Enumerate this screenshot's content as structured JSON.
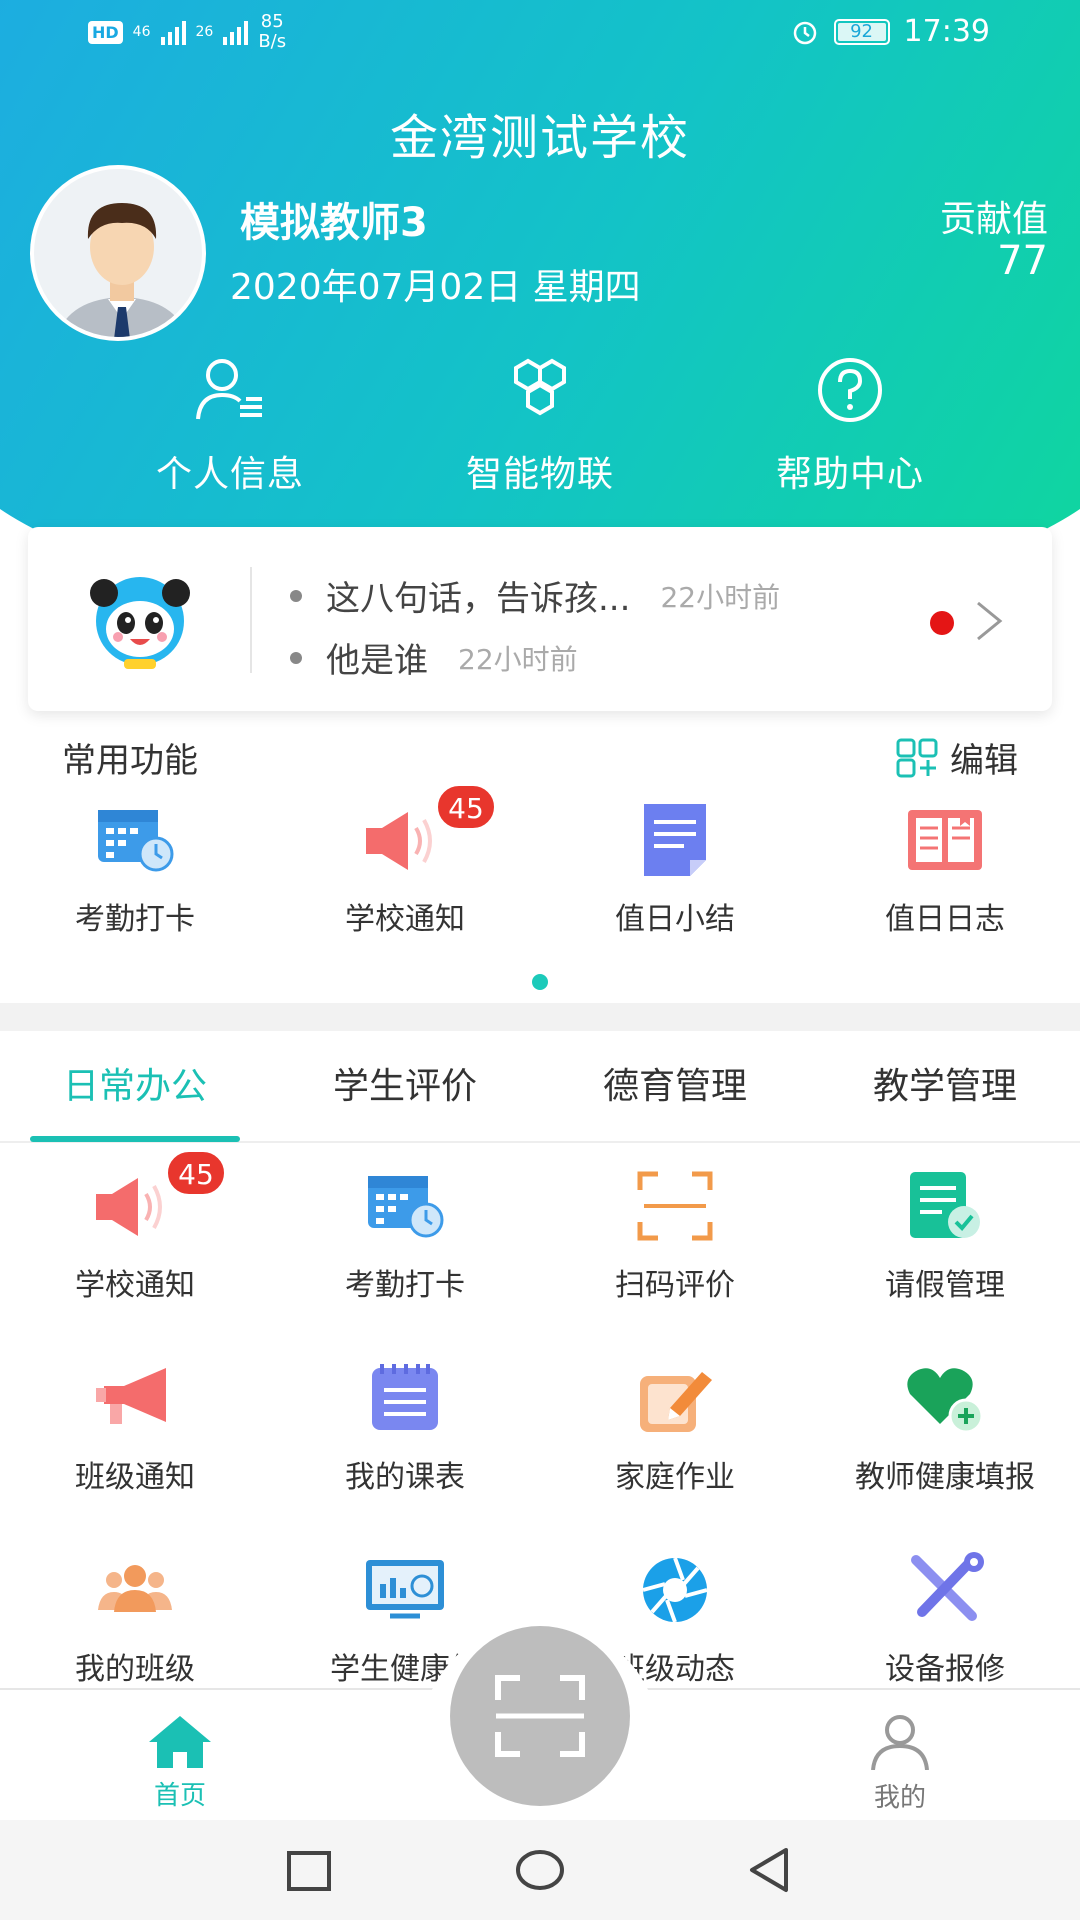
{
  "status_bar": {
    "network_left": "46",
    "network_right": "26",
    "speed": "85",
    "speed_unit": "B/s",
    "battery": "92",
    "time": "17:39"
  },
  "header": {
    "school_name": "金湾测试学校",
    "teacher_name": "模拟教师3",
    "date": "2020年07月02日 星期四",
    "contribution_label": "贡献值",
    "contribution_value": "77"
  },
  "quick_actions": [
    {
      "label": "个人信息",
      "icon": "person-info-icon"
    },
    {
      "label": "智能物联",
      "icon": "iot-hexagon-icon"
    },
    {
      "label": "帮助中心",
      "icon": "help-circle-icon"
    }
  ],
  "notices": [
    {
      "text": "这八句话，告诉孩...",
      "time": "22小时前"
    },
    {
      "text": "他是谁",
      "time": "22小时前"
    }
  ],
  "common": {
    "title": "常用功能",
    "edit_label": "编辑",
    "items": [
      {
        "label": "考勤打卡",
        "icon": "calendar-clock-icon"
      },
      {
        "label": "学校通知",
        "icon": "megaphone-icon",
        "badge": "45"
      },
      {
        "label": "值日小结",
        "icon": "document-icon"
      },
      {
        "label": "值日日志",
        "icon": "newspaper-icon"
      }
    ]
  },
  "tabs": [
    "日常办公",
    "学生评价",
    "德育管理",
    "教学管理"
  ],
  "office_items": [
    {
      "label": "学校通知",
      "icon": "megaphone-icon",
      "badge": "45"
    },
    {
      "label": "考勤打卡",
      "icon": "calendar-clock-icon"
    },
    {
      "label": "扫码评价",
      "icon": "scan-frame-icon"
    },
    {
      "label": "请假管理",
      "icon": "leave-form-icon"
    },
    {
      "label": "班级通知",
      "icon": "loudspeaker-icon"
    },
    {
      "label": "我的课表",
      "icon": "timetable-icon"
    },
    {
      "label": "家庭作业",
      "icon": "homework-edit-icon"
    },
    {
      "label": "教师健康填报",
      "icon": "health-heart-icon"
    },
    {
      "label": "我的班级",
      "icon": "group-people-icon"
    },
    {
      "label": "学生健康统",
      "icon": "health-chart-icon"
    },
    {
      "label": "班级动态",
      "icon": "aperture-icon"
    },
    {
      "label": "设备报修",
      "icon": "repair-tools-icon"
    }
  ],
  "bottom_nav": {
    "home": "首页",
    "mine": "我的"
  },
  "colors": {
    "accent": "#1bc0b4",
    "gradient_start": "#1fa8e6",
    "gradient_end": "#0fd89a",
    "badge": "#e8362d"
  }
}
